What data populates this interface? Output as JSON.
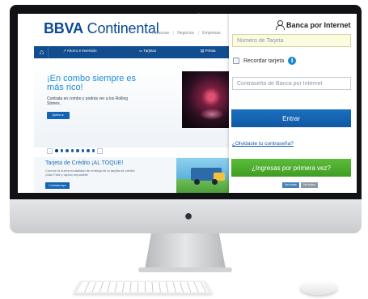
{
  "site": {
    "logo_bold": "BBVA",
    "logo_light": " Continental",
    "top_links": [
      "Personas",
      "|",
      "Negocios",
      "|",
      "Empresas"
    ],
    "nav": {
      "items": [
        "Ahorro e Inversión",
        "Tarjetas",
        "Présta"
      ]
    },
    "hero": {
      "title": "¡En combo siempre es más rico!",
      "text": "Contrata en combo y podrás ver a los Rolling Stones.",
      "button": "Quiero ►"
    },
    "carousel_dots": 8,
    "promo": {
      "title": "Tarjeta de Crédito ¡AL TOQUE!",
      "text": "Conoce la nueva modalidad de entrega de tu tarjeta de crédito ¡Más Fácil y rápido Imposible!",
      "button": "Contrata Aquí"
    },
    "pills": [
      "Ver todas",
      "Ver todos"
    ]
  },
  "login": {
    "title": "Banca por Internet",
    "card_placeholder": "Número de Tarjeta",
    "remember_label": "Recordar tarjeta",
    "password_placeholder": "Contraseña de Banca por Internet",
    "enter_button": "Entrar",
    "forgot_link": "¿Olvidaste tu contraseña?",
    "first_time_button": "¿Ingresas por primera vez?"
  },
  "colors": {
    "brand_blue": "#124e8f",
    "button_blue": "#1464b4",
    "button_green": "#4caf2f"
  },
  "icons": {
    "home": "home-icon",
    "user": "user-icon",
    "info": "info-icon",
    "apple": "apple-logo-icon"
  }
}
